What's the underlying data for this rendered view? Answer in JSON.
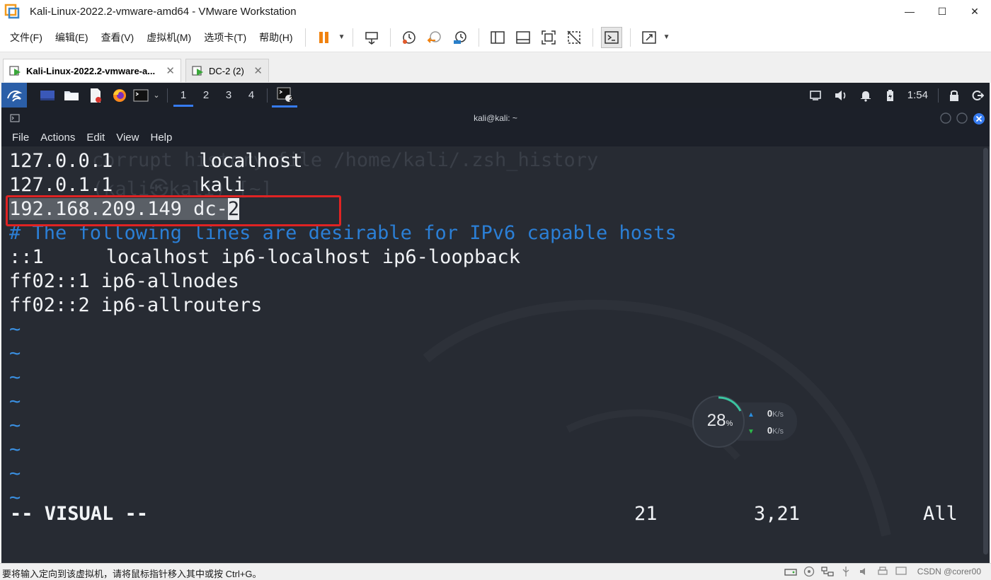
{
  "window": {
    "title": "Kali-Linux-2022.2-vmware-amd64 - VMware Workstation",
    "minimize": "—",
    "maximize": "☐",
    "close": "✕"
  },
  "menu": [
    "文件(F)",
    "编辑(E)",
    "查看(V)",
    "虚拟机(M)",
    "选项卡(T)",
    "帮助(H)"
  ],
  "tabs": [
    {
      "label": "Kali-Linux-2022.2-vmware-a...",
      "active": true
    },
    {
      "label": "DC-2 (2)",
      "active": false
    }
  ],
  "kali_panel": {
    "workspaces": [
      "1",
      "2",
      "3",
      "4"
    ],
    "active_workspace": "1",
    "terminal_badge": "2",
    "clock": "1:54"
  },
  "terminal": {
    "title": "kali@kali: ~",
    "menu": [
      "File",
      "Actions",
      "Edit",
      "View",
      "Help"
    ],
    "bg_ghost_1": "corrupt history file /home/kali/.zsh_history",
    "bg_ghost_2": "(kali㉿kali)-[~]",
    "lines": [
      {
        "a": "127.0.0.1",
        "b": "localhost"
      },
      {
        "a": "127.0.1.1",
        "b": "kali"
      },
      {
        "selected": "192.168.209.149 dc-",
        "cursor_char": "2"
      },
      {
        "comment": "# The following lines are desirable for IPv6 capable hosts"
      },
      {
        "a": "::1",
        "b": "localhost ip6-localhost ip6-loopback"
      },
      {
        "a": "ff02::1",
        "b": "ip6-allnodes"
      },
      {
        "a": "ff02::2",
        "b": "ip6-allrouters"
      }
    ],
    "tilde": "~",
    "tilde_count": 8,
    "mode": "-- VISUAL --",
    "sel_count": "21",
    "position": "3,21",
    "scroll": "All"
  },
  "monitor": {
    "percent": "28",
    "percent_unit": "%",
    "upload": "0",
    "download": "0",
    "unit": "K/s"
  },
  "statusbar": {
    "message": "要将输入定向到该虚拟机，请将鼠标指针移入其中或按 Ctrl+G。",
    "watermark": "CSDN @corer00"
  },
  "colors": {
    "accent": "#367bf0",
    "highlight": "#e02323",
    "comment": "#2b7fd6"
  }
}
